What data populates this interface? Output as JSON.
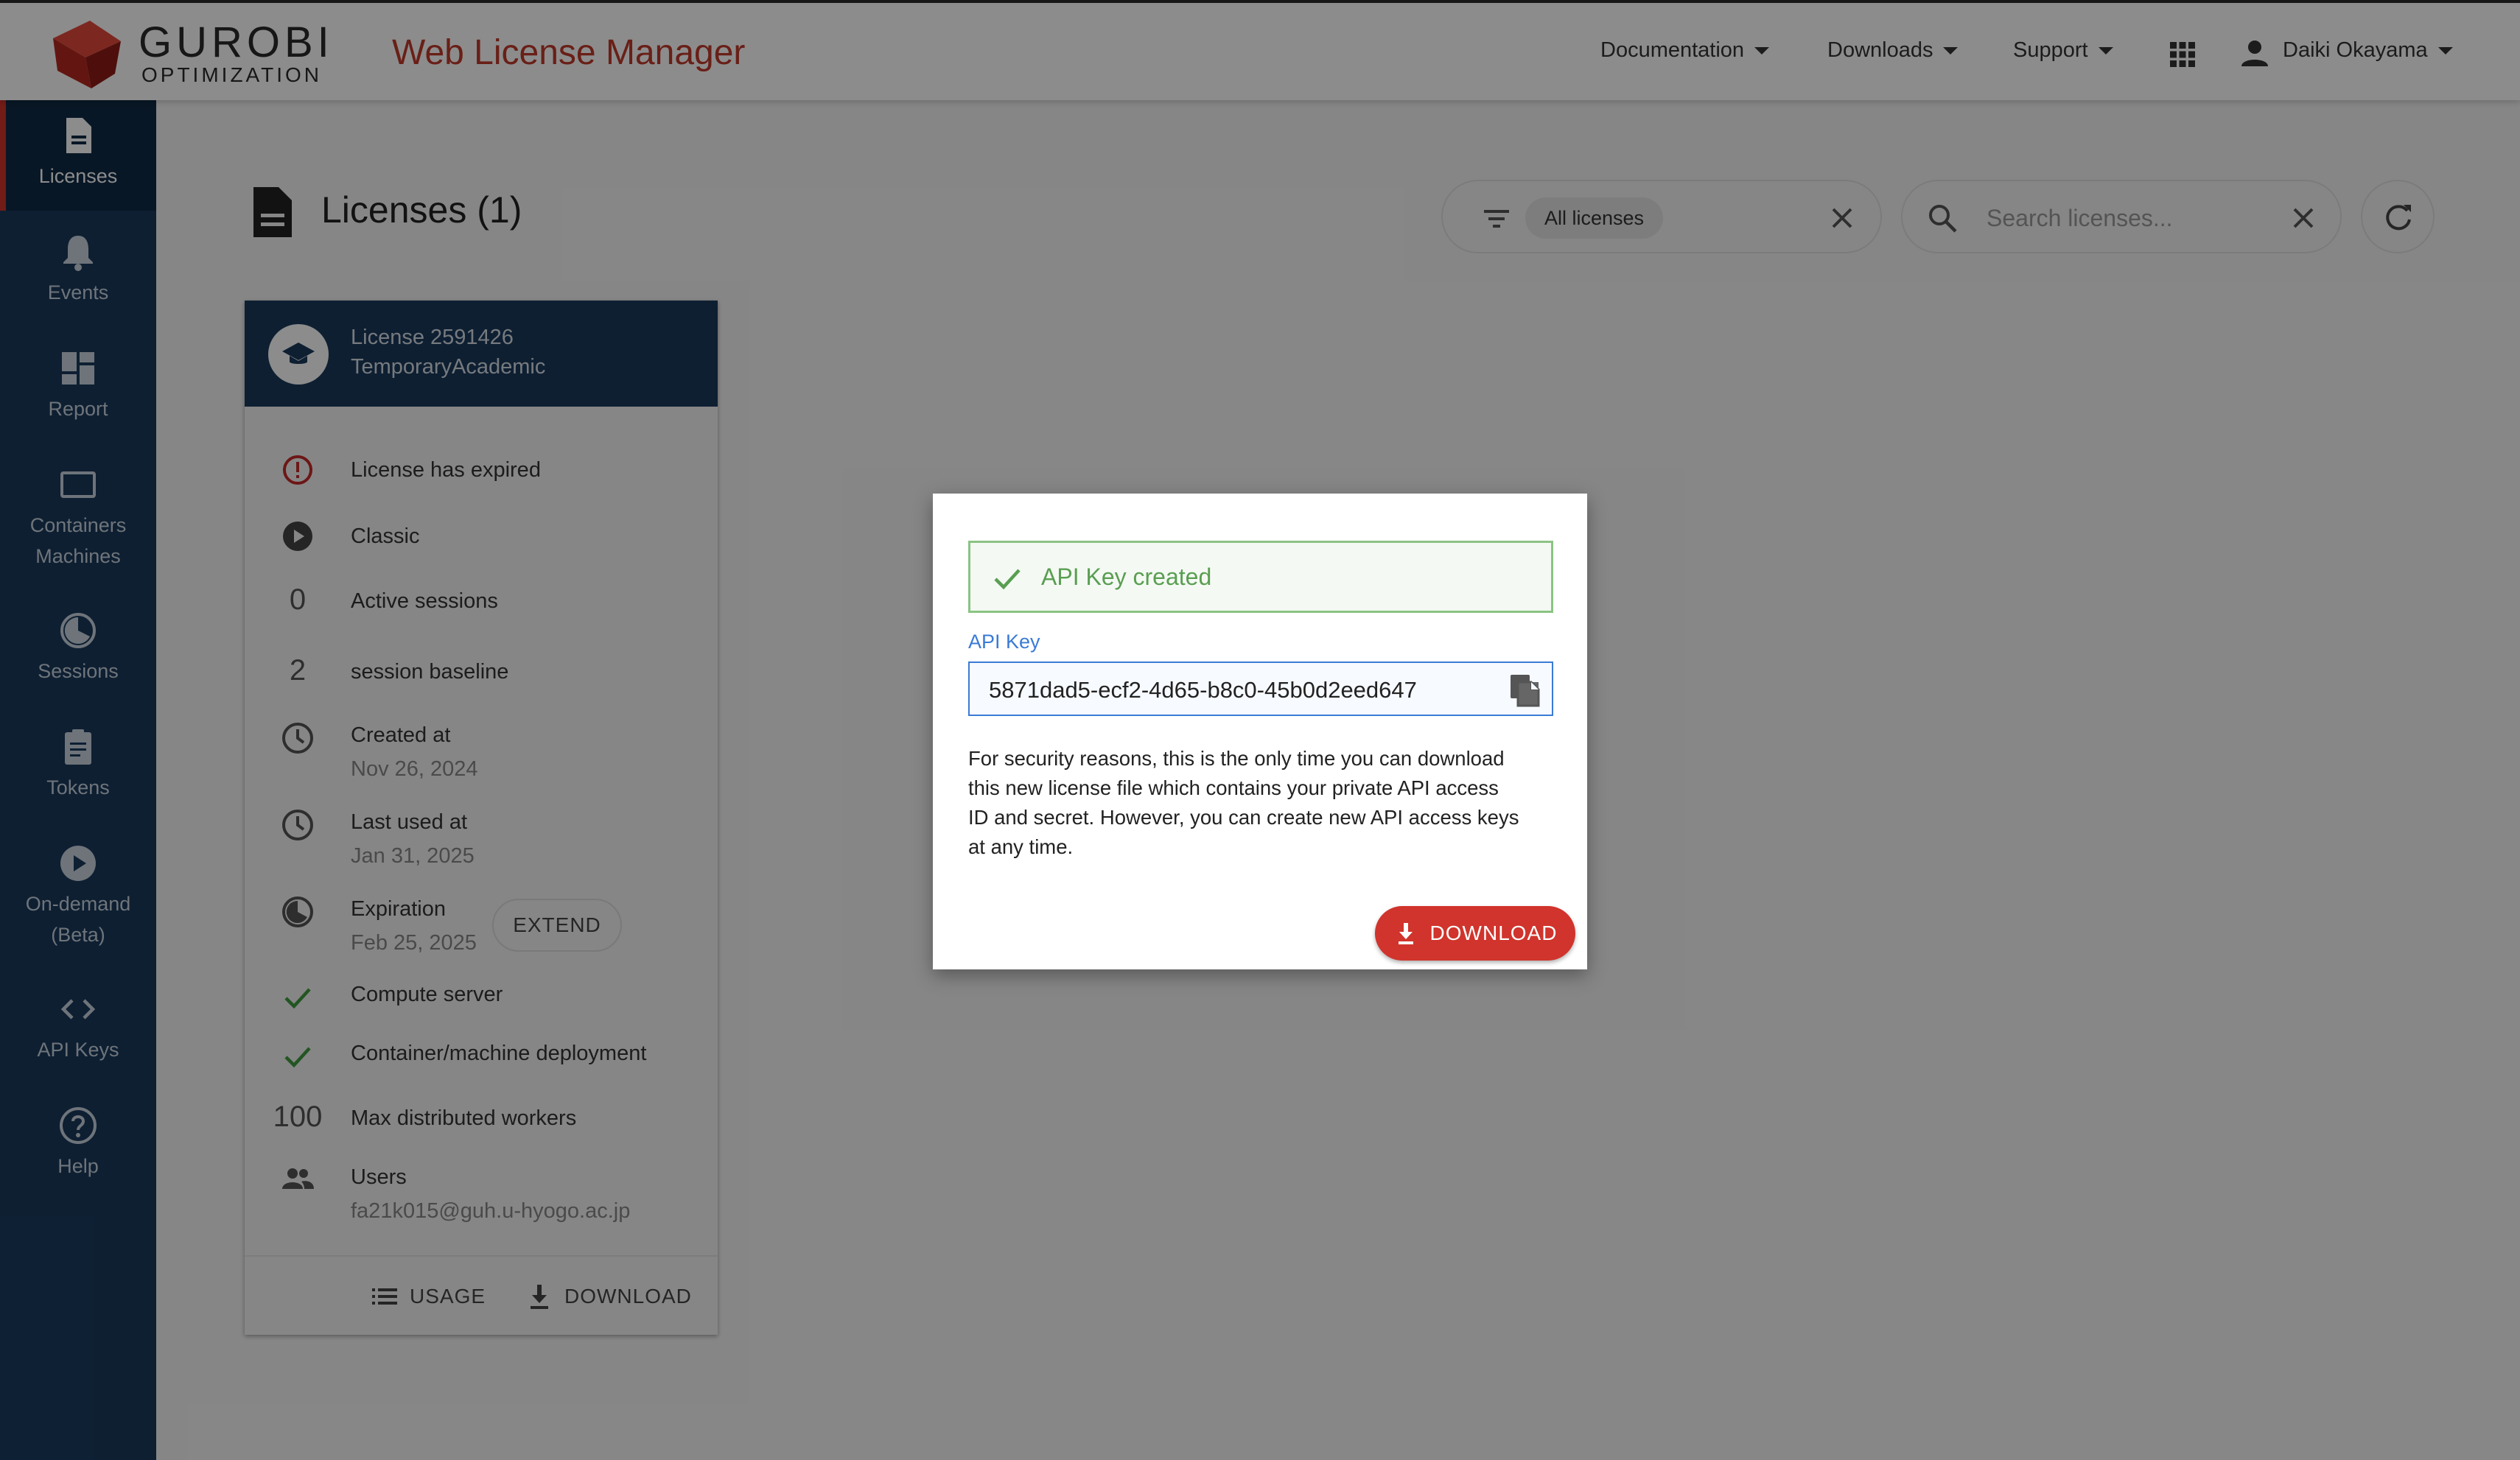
{
  "brand": {
    "logo_word": "GUROBI",
    "logo_sub": "OPTIMIZATION",
    "app_title": "Web License Manager",
    "accent_color": "#d0342c",
    "sidebar_color": "#1a3a5c"
  },
  "topnav": {
    "documentation": "Documentation",
    "downloads": "Downloads",
    "support": "Support",
    "apps_icon": "grid-apps-icon",
    "user_name": "Daiki Okayama"
  },
  "sidebar": {
    "items": [
      {
        "label": "Licenses",
        "icon": "document-icon",
        "active": true
      },
      {
        "label": "Events",
        "icon": "bell-icon"
      },
      {
        "label": "Report",
        "icon": "dashboard-icon"
      },
      {
        "label1": "Containers",
        "label2": "Machines",
        "icon": "monitor-icon"
      },
      {
        "label": "Sessions",
        "icon": "pie-clock-icon"
      },
      {
        "label": "Tokens",
        "icon": "clipboard-icon"
      },
      {
        "label1": "On-demand",
        "label2": "(Beta)",
        "icon": "play-circle-icon"
      },
      {
        "label": "API Keys",
        "icon": "code-icon"
      },
      {
        "label": "Help",
        "icon": "help-circle-icon"
      }
    ]
  },
  "main": {
    "title": "Licenses (1)",
    "filter_chip": "All licenses",
    "search_placeholder": "Search licenses..."
  },
  "license_card": {
    "line1": "License 2591426",
    "line2": "TemporaryAcademic",
    "expired": "License has expired",
    "classic": "Classic",
    "active_sessions_count": "0",
    "active_sessions_label": "Active sessions",
    "baseline_count": "2",
    "baseline_label": "session baseline",
    "created_label": "Created at",
    "created_value": "Nov 26, 2024",
    "last_used_label": "Last used at",
    "last_used_value": "Jan 31, 2025",
    "expiration_label": "Expiration",
    "expiration_value": "Feb 25, 2025",
    "extend_label": "EXTEND",
    "compute_server": "Compute server",
    "container_deploy": "Container/machine deployment",
    "workers_count": "100",
    "workers_label": "Max distributed workers",
    "users_label": "Users",
    "users_value": "fa21k015@guh.u-hyogo.ac.jp",
    "usage_label": "USAGE",
    "download_label": "DOWNLOAD"
  },
  "dialog": {
    "alert_text": "API Key created",
    "api_key_label": "API Key",
    "api_key_value": "5871dad5-ecf2-4d65-b8c0-45b0d2eed647",
    "body_line1": "For security reasons, this is the only time you can download",
    "body_line2": "this new license file which contains your private API access",
    "body_line3": "ID and secret. However, you can create new API access keys",
    "body_line4": "at any time.",
    "download_label": "DOWNLOAD"
  }
}
